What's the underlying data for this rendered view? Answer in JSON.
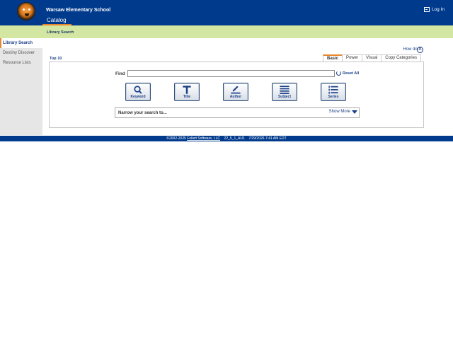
{
  "header": {
    "school_name": "Warsaw Elementary School",
    "login_label": "Log In",
    "active_tab": "Catalog"
  },
  "subheader": {
    "title": "Library Search"
  },
  "sidebar": {
    "items": [
      {
        "label": "Library Search",
        "active": true
      },
      {
        "label": "Destiny Discover",
        "active": false
      },
      {
        "label": "Resource Lists",
        "active": false
      }
    ]
  },
  "main": {
    "howdo": "How do I...",
    "help_glyph": "?",
    "top10": "Top 10",
    "tabs": [
      {
        "label": "Basic",
        "active": true
      },
      {
        "label": "Power",
        "active": false
      },
      {
        "label": "Visual",
        "active": false
      },
      {
        "label": "Copy Categories",
        "active": false
      }
    ],
    "find_label": "Find",
    "find_value": "",
    "reset_label": "Reset All",
    "search_buttons": [
      {
        "label": "Keyword",
        "icon": "magnifier-icon"
      },
      {
        "label": "Title",
        "icon": "title-t-icon"
      },
      {
        "label": "Author",
        "icon": "pen-icon"
      },
      {
        "label": "Subject",
        "icon": "lines-icon"
      },
      {
        "label": "Series",
        "icon": "numbered-list-icon"
      }
    ],
    "narrow_label": "Narrow your search to...",
    "show_more": "Show More"
  },
  "footer": {
    "copyright": "©2002-2025",
    "company": "Follett Software, LLC",
    "version": "22_5_1_AU1",
    "datetime": "7/29/2026 7:41 AM EDT"
  },
  "colors": {
    "header_bg": "#003a8c",
    "subheader_bg": "#d3e7a2",
    "accent_orange": "#e8872b",
    "link_blue": "#1a3f87"
  }
}
